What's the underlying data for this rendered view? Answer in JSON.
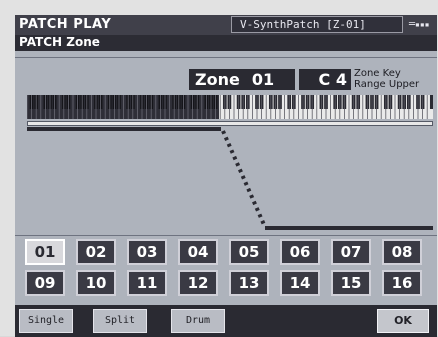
{
  "header": {
    "title": "PATCH PLAY",
    "patch_name": "V-SynthPatch [Z-01]",
    "status_icon": "="
  },
  "screen": {
    "title": "PATCH Zone"
  },
  "zone_display": {
    "zone_label": "Zone",
    "zone_number": "01",
    "key_value": "C 4",
    "key_caption_line1": "Zone Key",
    "key_caption_line2": "Range Upper"
  },
  "zones": [
    "01",
    "02",
    "03",
    "04",
    "05",
    "06",
    "07",
    "08",
    "09",
    "10",
    "11",
    "12",
    "13",
    "14",
    "15",
    "16"
  ],
  "selected_zone": "01",
  "mode_buttons": [
    "Single",
    "Split",
    "Drum"
  ],
  "ok_label": "OK",
  "colors": {
    "screen_bg": "#aeb3bc",
    "dark_bar": "#2a2a32",
    "selected_zone_bg": "#d8d8dc"
  }
}
